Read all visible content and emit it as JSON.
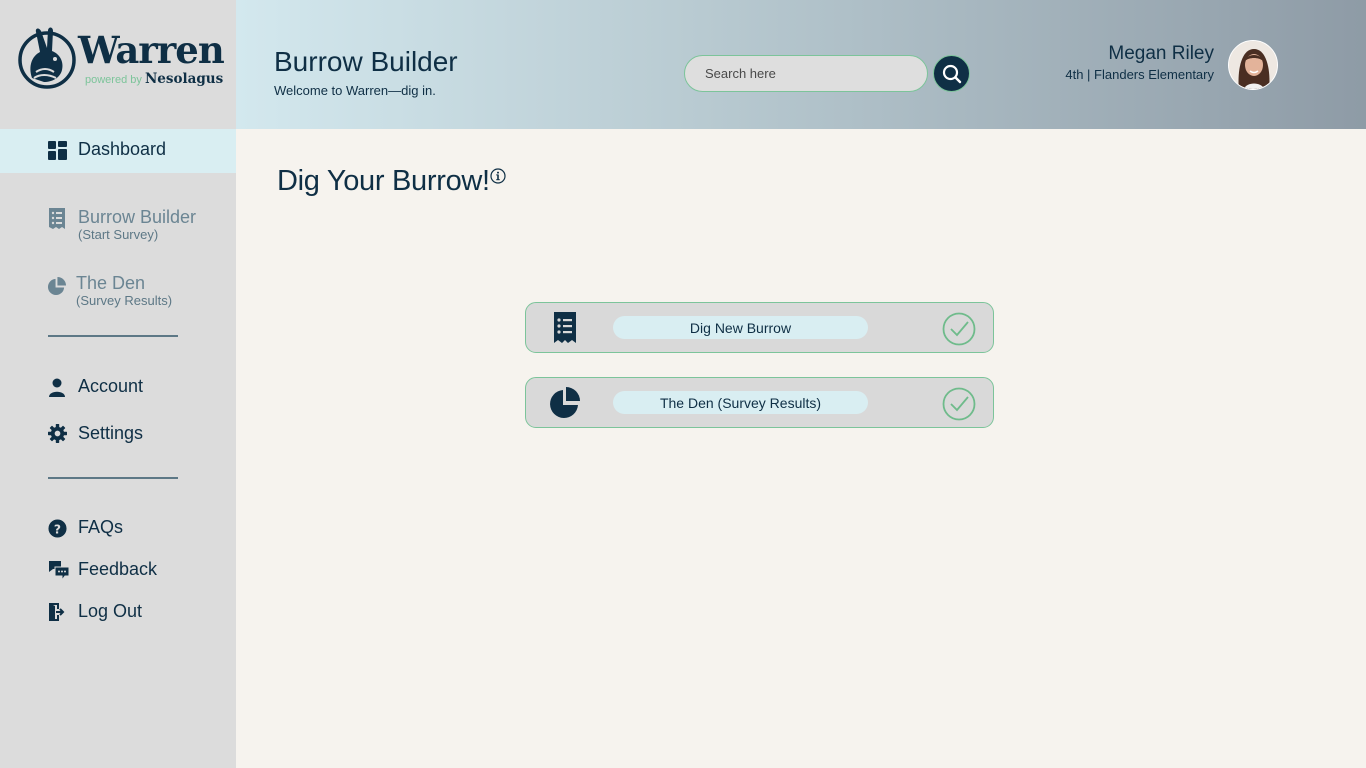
{
  "brand": {
    "name": "Warren",
    "powered_by": "powered by",
    "company": "Nesolagus"
  },
  "sidebar": {
    "items": [
      {
        "label": "Dashboard",
        "icon": "dashboard-icon"
      },
      {
        "label": "Burrow Builder",
        "sub": "(Start Survey)",
        "icon": "survey-icon"
      },
      {
        "label": "The Den",
        "sub": "(Survey Results)",
        "icon": "pie-chart-icon"
      },
      {
        "label": "Account",
        "icon": "user-icon"
      },
      {
        "label": "Settings",
        "icon": "gear-icon"
      },
      {
        "label": "FAQs",
        "icon": "question-icon"
      },
      {
        "label": "Feedback",
        "icon": "chat-icon"
      },
      {
        "label": "Log Out",
        "icon": "logout-icon"
      }
    ]
  },
  "header": {
    "title": "Burrow Builder",
    "subtitle": "Welcome to Warren—dig in.",
    "search_placeholder": "Search here",
    "user_name": "Megan Riley",
    "user_meta": "4th | Flanders Elementary"
  },
  "main": {
    "title": "Dig Your Burrow!",
    "cards": [
      {
        "label": "Dig New Burrow",
        "icon": "survey-icon"
      },
      {
        "label": "The Den (Survey Results)",
        "icon": "pie-chart-icon"
      }
    ]
  },
  "colors": {
    "navy": "#0f2f45",
    "accent_green": "#7cc49a",
    "active_bg": "#d9eef2",
    "sidebar_bg": "#dcdcdc",
    "page_bg": "#f6f3ee"
  }
}
